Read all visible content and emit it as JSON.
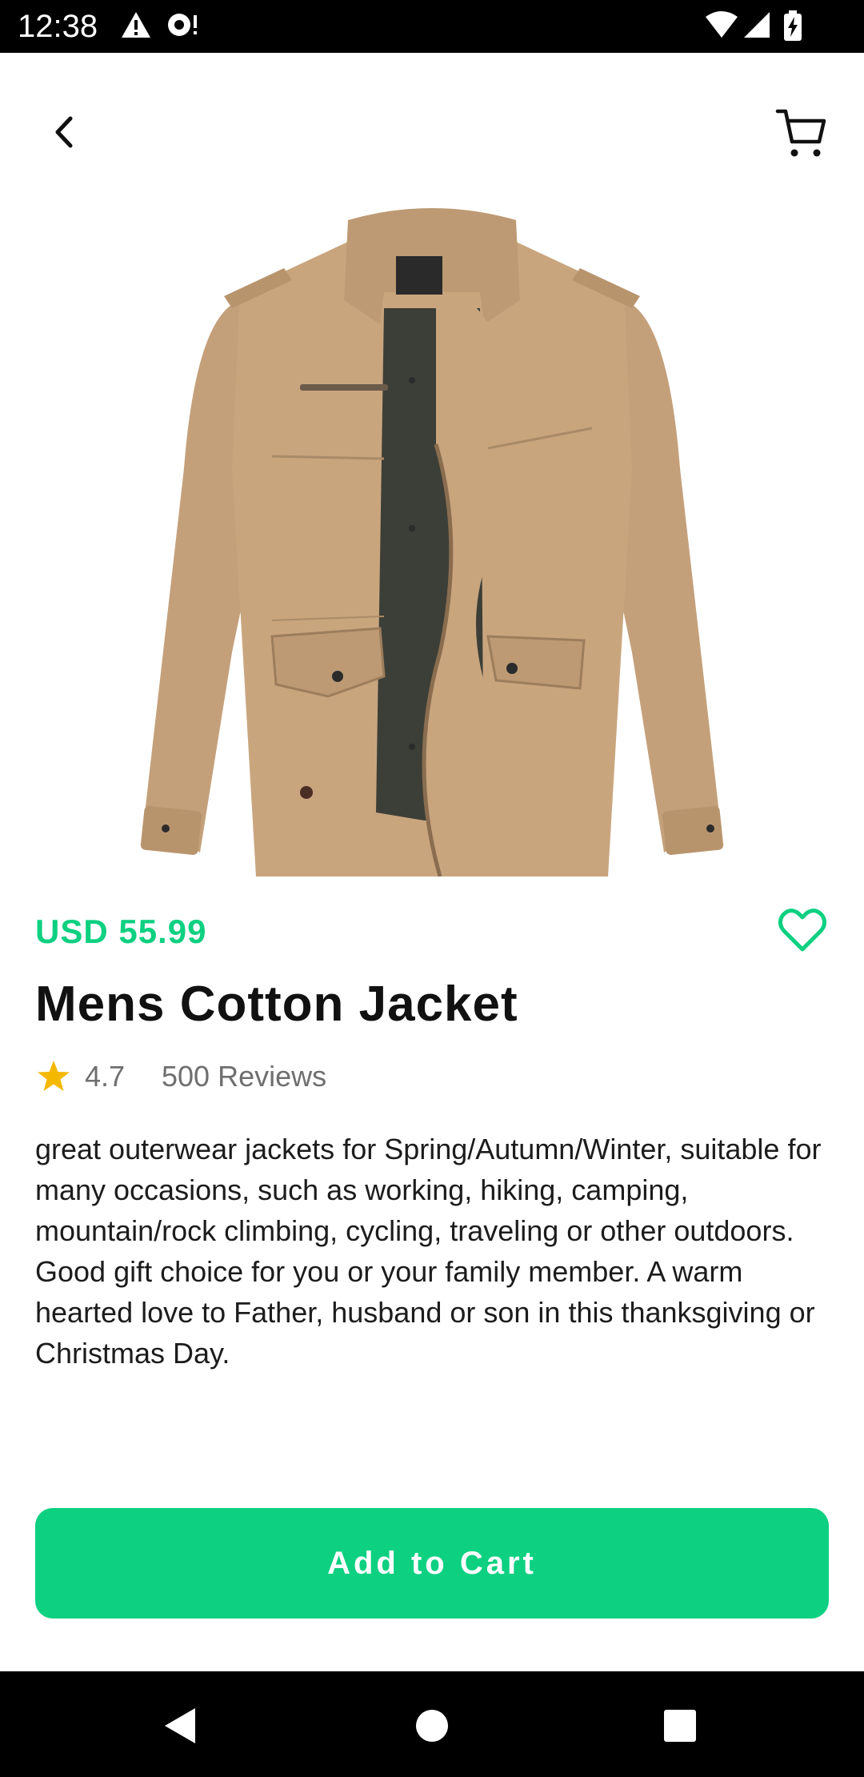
{
  "status_bar": {
    "time": "12:38",
    "icons": [
      "warning-icon",
      "notification-icon",
      "wifi-icon",
      "signal-icon",
      "battery-charging-icon"
    ]
  },
  "app_bar": {
    "back_icon": "chevron-left-icon",
    "cart_icon": "cart-icon"
  },
  "product": {
    "image_alt": "product-jacket-image",
    "price": "USD 55.99",
    "title": "Mens Cotton Jacket",
    "rating": "4.7",
    "reviews": "500 Reviews",
    "description": "great outerwear jackets for Spring/Autumn/Winter, suitable for many occasions, such as working, hiking, camping, mountain/rock climbing, cycling, traveling or other outdoors. Good gift choice for you or your family member. A warm hearted love to Father, husband or son in this thanksgiving or Christmas Day.",
    "favorite_icon": "heart-outline-icon"
  },
  "actions": {
    "add_to_cart_label": "Add to Cart"
  },
  "nav_bar": {
    "icons": [
      "nav-back-icon",
      "nav-home-icon",
      "nav-recents-icon"
    ]
  },
  "colors": {
    "accent": "#0dd081",
    "star": "#f5b800",
    "jacket": "#c9a57e"
  }
}
